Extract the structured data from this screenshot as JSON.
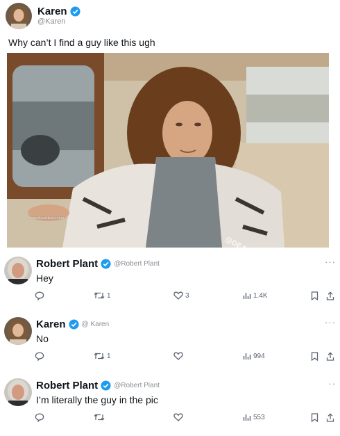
{
  "post": {
    "author": {
      "name": "Karen",
      "handle": "@Karen",
      "verified": true,
      "avatar_icon": "woman-avatar-icon"
    },
    "text": "Why can’t I find a guy like this ugh",
    "image": {
      "description_icon": "photo-man-in-car",
      "watermark_url": "www.deadikace.com",
      "watermark_tag": "@DEADIKACE"
    }
  },
  "replies": [
    {
      "name": "Robert Plant",
      "handle": "@Robert Plant",
      "verified": true,
      "avatar_icon": "older-man-avatar-icon",
      "text": "Hey",
      "retweets": "1",
      "likes": "3",
      "views": "1.4K",
      "more": "···"
    },
    {
      "name": "Karen",
      "handle": "@ Karen",
      "verified": true,
      "avatar_icon": "woman-avatar-icon",
      "text": "No",
      "retweets": "1",
      "likes": "",
      "views": "994",
      "more": "···"
    },
    {
      "name": "Robert Plant",
      "handle": "@Robert Plant",
      "verified": true,
      "avatar_icon": "older-man-avatar-icon",
      "text": "I’m literally the guy in the pic",
      "retweets": "",
      "likes": "",
      "views": "553",
      "more": "··"
    }
  ],
  "colors": {
    "verified": "#1d9bf0",
    "text": "#0f1419",
    "secondary": "#8a8f95",
    "icon": "#5b6470"
  }
}
